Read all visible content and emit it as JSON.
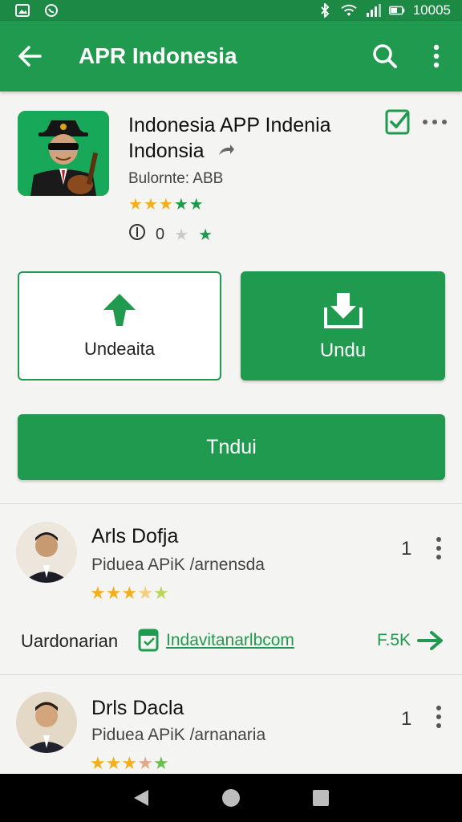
{
  "status_bar": {
    "time": "10005",
    "icons": [
      "photo-icon",
      "whatsapp-icon",
      "bluetooth-icon",
      "wifi-icon",
      "signal-icon",
      "battery-icon"
    ]
  },
  "app_bar": {
    "title": "APR Indonesia",
    "icons": [
      "back-arrow-icon",
      "search-icon",
      "more-vert-icon"
    ],
    "color": "#1f9a4e"
  },
  "app": {
    "name_line1": "Indonesia APP Indenia",
    "name_line2": "Indonsia",
    "developer": "Bulornte: ABB",
    "rating": 4.5,
    "meta_left": "0",
    "meta_mid": "0"
  },
  "buttons": {
    "outline_label": "Undeaita",
    "filled_label": "Undu",
    "wide_label": "Tndui"
  },
  "reviews": [
    {
      "name": "Arls Dofja",
      "subtitle": "Piduea APiK /arnensda",
      "rating": 3.5,
      "count": "1"
    },
    {
      "name": "Drls Dacla",
      "subtitle": "Piduea APiK /arnanaria",
      "rating": 3.5,
      "count": "1"
    }
  ],
  "link_row": {
    "label": "Uardonarian",
    "url": "Indavitanarlbcom",
    "count": "F.5K"
  },
  "colors": {
    "accent": "#1f9a4e",
    "star": "#f2b01e"
  }
}
